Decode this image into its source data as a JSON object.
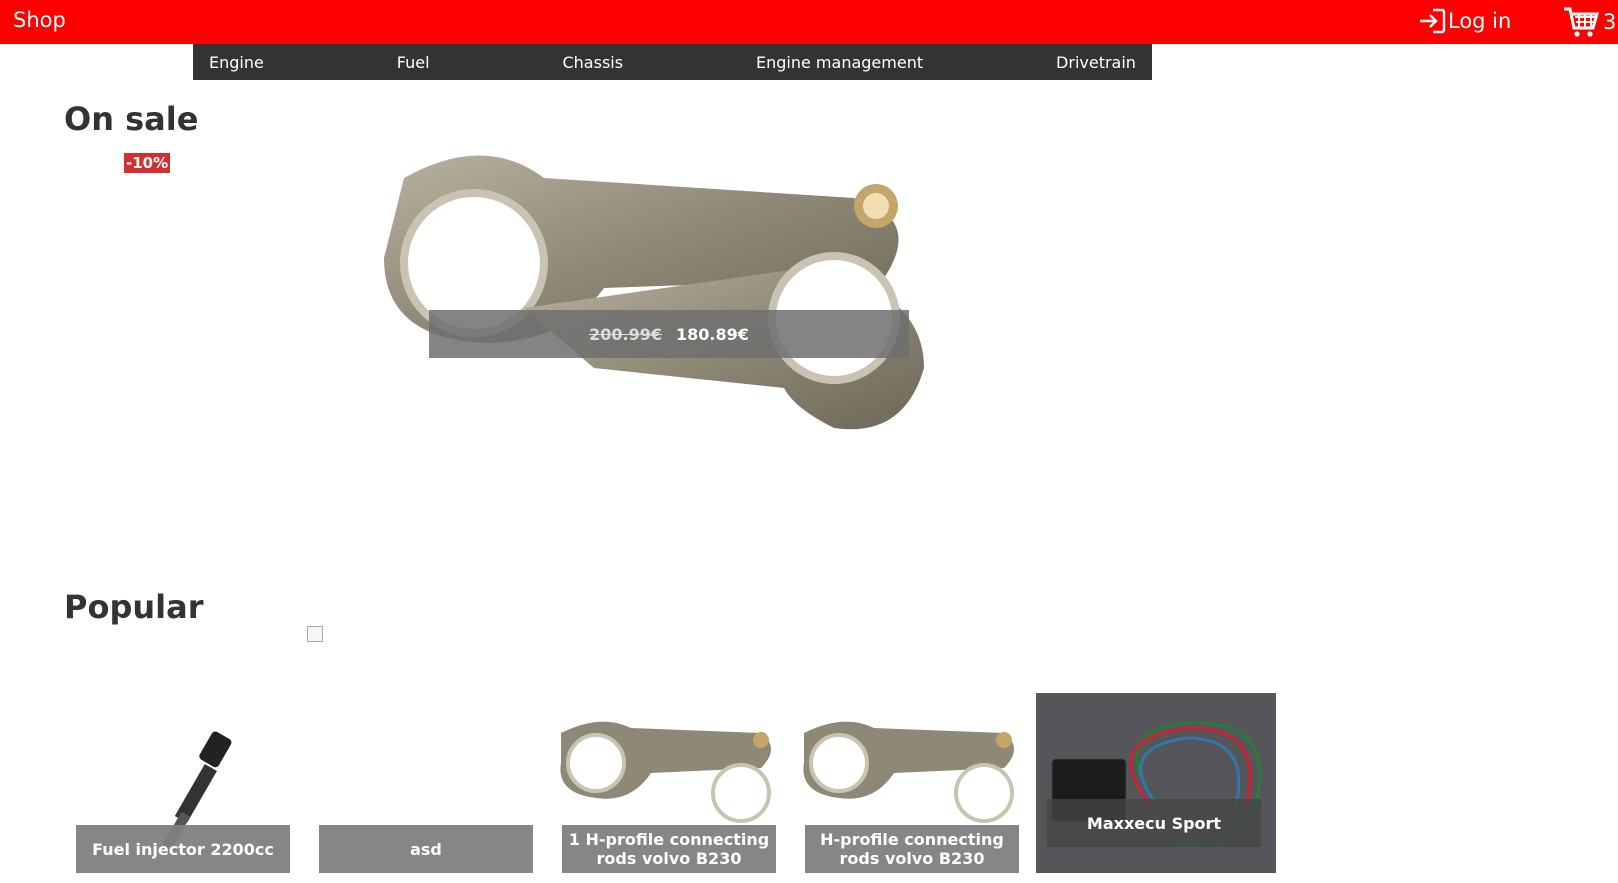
{
  "header": {
    "brand": "Shop",
    "login": "Log in",
    "cart_count": "3"
  },
  "nav": [
    "Engine",
    "Fuel",
    "Chassis",
    "Engine management",
    "Drivetrain"
  ],
  "sale": {
    "title": "On sale",
    "badge": "-10%",
    "old_price": "200.99€",
    "price": "180.89€"
  },
  "popular": {
    "title": "Popular",
    "items": [
      {
        "name": "Fuel injector 2200cc"
      },
      {
        "name": "asd"
      },
      {
        "name": "1 H-profile connecting rods volvo B230"
      },
      {
        "name": "H-profile connecting rods volvo B230"
      },
      {
        "name": "Maxxecu Sport"
      }
    ]
  },
  "colors": {
    "header": "#ff0000",
    "nav": "#333333",
    "badge": "#d32f2f"
  }
}
